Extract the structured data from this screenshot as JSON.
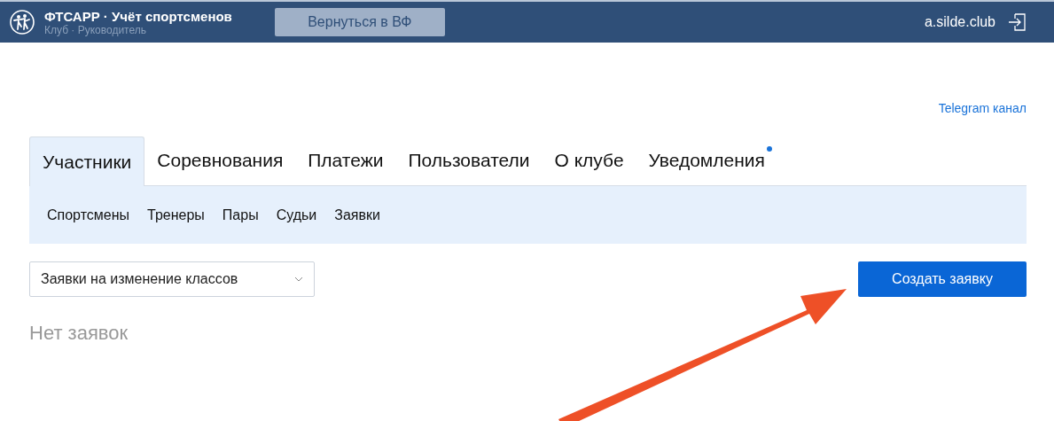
{
  "header": {
    "title": "ФТСАРР · Учёт спортсменов",
    "subtitle": "Клуб · Руководитель",
    "back_button": "Вернуться в ВФ",
    "user": "a.silde.club"
  },
  "telegram_link": "Telegram канал",
  "tabs": [
    {
      "label": "Участники",
      "selected": true,
      "has_new": false
    },
    {
      "label": "Соревнования",
      "selected": false,
      "has_new": false
    },
    {
      "label": "Платежи",
      "selected": false,
      "has_new": false
    },
    {
      "label": "Пользователи",
      "selected": false,
      "has_new": false
    },
    {
      "label": "О клубе",
      "selected": false,
      "has_new": false
    },
    {
      "label": "Уведомления",
      "selected": false,
      "has_new": true
    }
  ],
  "subtabs": [
    "Спортсмены",
    "Тренеры",
    "Пары",
    "Судьи",
    "Заявки"
  ],
  "filter_select": {
    "value": "Заявки на изменение классов"
  },
  "create_button": "Создать заявку",
  "empty_message": "Нет заявок"
}
